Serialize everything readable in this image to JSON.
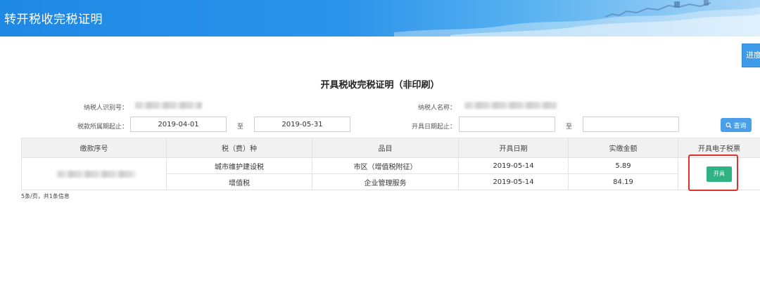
{
  "header": {
    "title": "转开税收完税证明"
  },
  "progress_button": {
    "label": "进度"
  },
  "page_title": "开具税收完税证明（非印刷）",
  "form": {
    "taxpayer_id_label": "纳税人识别号：",
    "taxpayer_name_label": "纳税人名称：",
    "tax_period_label": "税款所属期起止：",
    "tax_period_start": "2019-04-01",
    "tax_period_to": "至",
    "tax_period_end": "2019-05-31",
    "issue_date_label": "开具日期起止：",
    "issue_date_start": "",
    "issue_date_to": "至",
    "issue_date_end": "",
    "query_button": "查询"
  },
  "table": {
    "headers": [
      "缴款序号",
      "税（费）种",
      "品目",
      "开具日期",
      "实缴金额",
      "开具电子税票"
    ],
    "rows": [
      {
        "tax_type": "城市维护建设税",
        "item": "市区（增值税附征）",
        "date": "2019-05-14",
        "amount": "5.89"
      },
      {
        "tax_type": "增值税",
        "item": "企业管理服务",
        "date": "2019-05-14",
        "amount": "84.19"
      }
    ],
    "issue_button": "开具"
  },
  "pager": {
    "info": "5条/页，共1条信息"
  },
  "colors": {
    "header_blue": "#1e88e5",
    "issue_green": "#2fb384",
    "highlight_red": "#e0312b",
    "query_blue": "#4a9fe8"
  }
}
